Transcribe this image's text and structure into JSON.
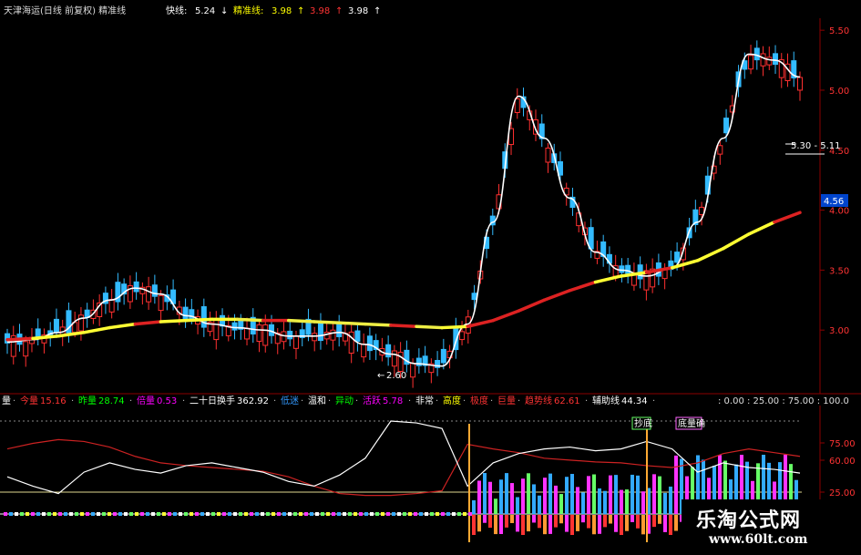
{
  "title": "天津海运(日线 前复权) 精准线",
  "top_legend": [
    {
      "label": "快线:",
      "value": "5.24",
      "arrow": "↓",
      "label_color": "#ffffff",
      "value_color": "#ffffff"
    },
    {
      "label": "精准线:",
      "value": "3.98",
      "arrow": "↑",
      "label_color": "#ffff00",
      "value_color": "#ffff00"
    },
    {
      "label": "",
      "value": "3.98",
      "arrow": "↑",
      "label_color": "#ff3333",
      "value_color": "#ff3333"
    },
    {
      "label": "",
      "value": "3.98",
      "arrow": "↑",
      "label_color": "#ffffff",
      "value_color": "#ffffff"
    }
  ],
  "price_axis": {
    "labels": [
      "5.50",
      "5.00",
      "4.50",
      "4.00",
      "3.50",
      "3.00"
    ],
    "current_price": "4.56",
    "annotation_high": "5.30 - 5.11",
    "annotation_low": "2.60"
  },
  "bottom_legend": [
    {
      "label": "量",
      "value": "",
      "color": "#ffffff"
    },
    {
      "label": "今量",
      "value": "15.16",
      "color": "#ff3333"
    },
    {
      "label": "昨量",
      "value": "28.74",
      "color": "#00ff00"
    },
    {
      "label": "倍量",
      "value": "0.53",
      "color": "#ff00ff"
    },
    {
      "label": "二十日换手",
      "value": "362.92",
      "color": "#ffffff"
    },
    {
      "label": "低迷",
      "value": "",
      "color": "#3399ff"
    },
    {
      "label": "温和",
      "value": "",
      "color": "#ffffff"
    },
    {
      "label": "异动",
      "value": "",
      "color": "#00ff00"
    },
    {
      "label": "活跃",
      "value": "5.78",
      "color": "#ff00ff"
    },
    {
      "label": "非常",
      "value": "",
      "color": "#ffffff"
    },
    {
      "label": "高度",
      "value": "",
      "color": "#ffff00"
    },
    {
      "label": "极度",
      "value": "",
      "color": "#ff3333"
    },
    {
      "label": "巨量",
      "value": "",
      "color": "#ff3333"
    },
    {
      "label": "趋势线",
      "value": "62.61",
      "color": "#ff3333"
    },
    {
      "label": "辅助线",
      "value": "44.34",
      "color": "#ffffff"
    }
  ],
  "bottom_scale": {
    "text": ": 0.00 : 25.00 : 75.00 : 100.0",
    "labels": [
      "75.00",
      "60.00",
      "25.00"
    ]
  },
  "signals": [
    "抄底",
    "底量确"
  ],
  "watermark": {
    "name": "乐淘公式网",
    "url": "www.60lt.com"
  },
  "chart_data": [
    {
      "type": "candlestick",
      "title": "天津海运(日线 前复权) 精准线",
      "ylim": [
        2.5,
        5.6
      ],
      "series": [
        {
          "name": "快线",
          "values": [
            2.9,
            2.92,
            2.98,
            3.1,
            3.25,
            3.35,
            3.3,
            3.12,
            3.05,
            3.02,
            3.0,
            2.95,
            2.95,
            2.98,
            2.88,
            2.8,
            2.72,
            2.7,
            3.05,
            3.9,
            4.95,
            4.6,
            4.1,
            3.65,
            3.5,
            3.45,
            3.52,
            3.9,
            4.6,
            5.3,
            5.25,
            5.11
          ]
        },
        {
          "name": "精准线",
          "values": [
            2.92,
            2.93,
            2.95,
            2.98,
            3.02,
            3.05,
            3.07,
            3.08,
            3.09,
            3.09,
            3.08,
            3.08,
            3.07,
            3.06,
            3.05,
            3.04,
            3.03,
            3.02,
            3.03,
            3.08,
            3.16,
            3.25,
            3.33,
            3.4,
            3.45,
            3.48,
            3.52,
            3.58,
            3.68,
            3.8,
            3.9,
            3.98
          ]
        }
      ]
    },
    {
      "type": "bar",
      "title": "",
      "ylim": [
        0,
        100
      ],
      "series": [
        {
          "name": "趋势线",
          "values": [
            70,
            76,
            80,
            78,
            72,
            62,
            55,
            52,
            50,
            48,
            46,
            40,
            30,
            22,
            20,
            20,
            22,
            25,
            75,
            70,
            66,
            60,
            58,
            56,
            55,
            52,
            50,
            55,
            65,
            70,
            66,
            62
          ]
        },
        {
          "name": "辅助线",
          "values": [
            40,
            30,
            22,
            45,
            55,
            48,
            44,
            52,
            55,
            50,
            45,
            35,
            30,
            42,
            60,
            100,
            98,
            92,
            30,
            55,
            65,
            70,
            72,
            68,
            70,
            78,
            70,
            45,
            55,
            50,
            48,
            44
          ]
        }
      ]
    }
  ]
}
